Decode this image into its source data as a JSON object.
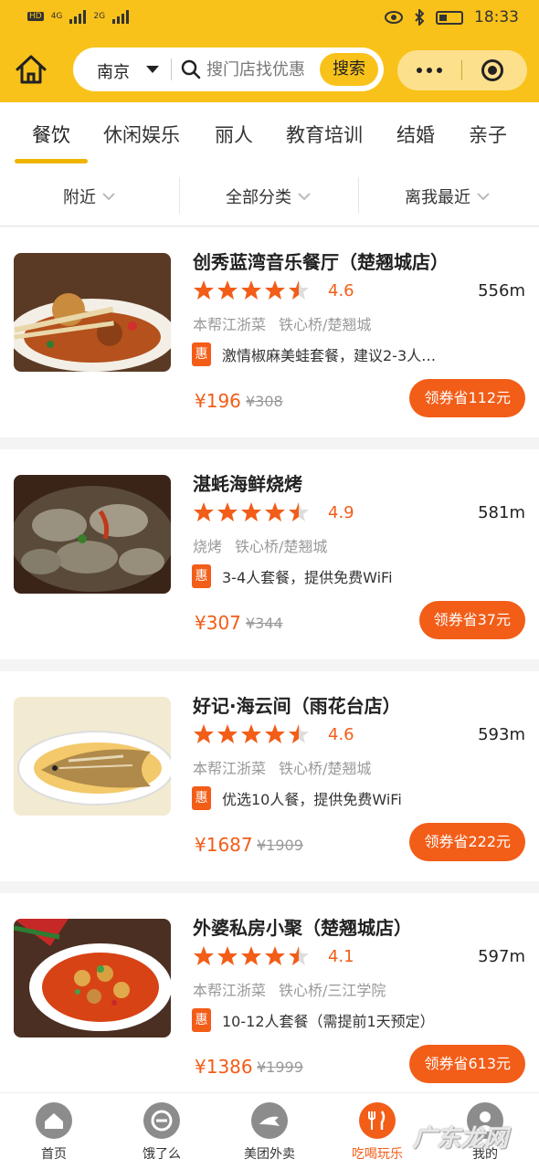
{
  "status_bar": {
    "left_badges": [
      "HD",
      "4G",
      "2G"
    ],
    "time": "18:33"
  },
  "header": {
    "city": "南京",
    "search_placeholder": "搜门店找优惠",
    "search_button": "搜索"
  },
  "tabs": [
    {
      "label": "餐饮",
      "active": true
    },
    {
      "label": "休闲娱乐"
    },
    {
      "label": "丽人"
    },
    {
      "label": "教育培训"
    },
    {
      "label": "结婚"
    },
    {
      "label": "亲子"
    }
  ],
  "filters": [
    "附近",
    "全部分类",
    "离我最近"
  ],
  "listings": [
    {
      "name": "创秀蓝湾音乐餐厅（楚翘城店）",
      "rating": "4.6",
      "distance": "556m",
      "tags": [
        "本帮江浙菜",
        "铁心桥/楚翘城"
      ],
      "deal_badge": "惠",
      "deal": "激情椒麻美蛙套餐，建议2-3人…",
      "price": "¥196",
      "original_price": "¥308",
      "coupon": "领券省112元"
    },
    {
      "name": "湛蚝海鲜烧烤",
      "rating": "4.9",
      "distance": "581m",
      "tags": [
        "烧烤",
        "铁心桥/楚翘城"
      ],
      "deal_badge": "惠",
      "deal": "3-4人套餐，提供免费WiFi",
      "price": "¥307",
      "original_price": "¥344",
      "coupon": "领券省37元"
    },
    {
      "name": "好记·海云间（雨花台店）",
      "rating": "4.6",
      "distance": "593m",
      "tags": [
        "本帮江浙菜",
        "铁心桥/楚翘城"
      ],
      "deal_badge": "惠",
      "deal": "优选10人餐，提供免费WiFi",
      "price": "¥1687",
      "original_price": "¥1909",
      "coupon": "领券省222元"
    },
    {
      "name": "外婆私房小聚（楚翘城店）",
      "rating": "4.1",
      "distance": "597m",
      "tags": [
        "本帮江浙菜",
        "铁心桥/三江学院"
      ],
      "deal_badge": "惠",
      "deal": "10-12人套餐（需提前1天预定）",
      "price": "¥1386",
      "original_price": "¥1999",
      "coupon": "领券省613元"
    }
  ],
  "bottom_nav": [
    {
      "label": "首页",
      "icon": "home-icon"
    },
    {
      "label": "饿了么",
      "icon": "eleme-icon"
    },
    {
      "label": "美团外卖",
      "icon": "kangaroo-icon"
    },
    {
      "label": "吃喝玩乐",
      "icon": "fork-knife-icon",
      "active": true
    },
    {
      "label": "我的",
      "icon": "user-icon"
    }
  ],
  "watermark": "广东龙网",
  "colors": {
    "brand_yellow": "#f9c21a",
    "accent_orange": "#f25d18"
  }
}
